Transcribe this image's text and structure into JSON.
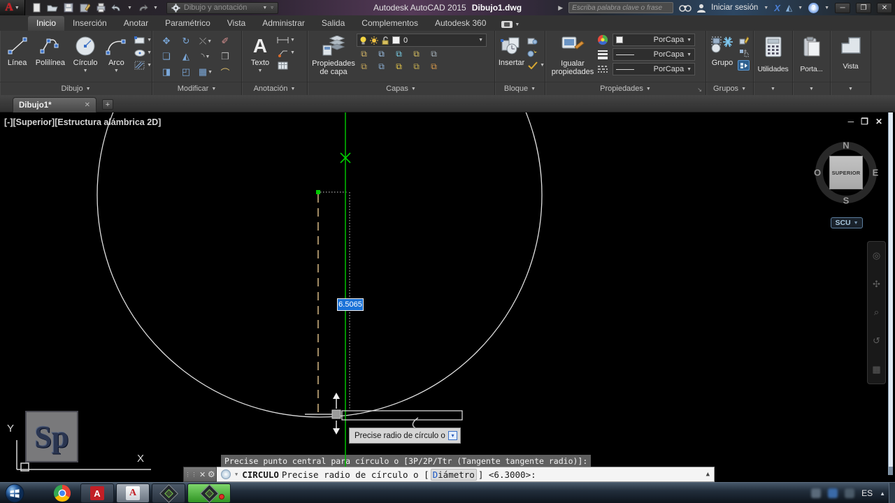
{
  "colors": {
    "accent_green": "#00c800",
    "selection_blue": "#1a72d8",
    "autocad_red": "#c81e23",
    "circle_stroke": "#e0e0e0",
    "tracking_tan": "#9a8560"
  },
  "titlebar": {
    "app_title": "Autodesk AutoCAD 2015",
    "doc_title": "Dibujo1.dwg",
    "workspace": "Dibujo y anotación",
    "search_placeholder": "Escriba palabra clave o frase",
    "signin_label": "Iniciar sesión"
  },
  "ribbon": {
    "tabs": [
      {
        "label": "Inicio",
        "active": true
      },
      {
        "label": "Inserción"
      },
      {
        "label": "Anotar"
      },
      {
        "label": "Paramétrico"
      },
      {
        "label": "Vista"
      },
      {
        "label": "Administrar"
      },
      {
        "label": "Salida"
      },
      {
        "label": "Complementos"
      },
      {
        "label": "Autodesk 360"
      }
    ],
    "dibujo": {
      "label": "Dibujo",
      "linea": "Línea",
      "polilinea": "Polilínea",
      "circulo": "Círculo",
      "arco": "Arco"
    },
    "modificar": {
      "label": "Modificar"
    },
    "anotacion": {
      "label": "Anotación",
      "texto": "Texto"
    },
    "capas": {
      "label": "Capas",
      "propiedades_de_capa": "Propiedades de capa",
      "current_layer": "0"
    },
    "bloque": {
      "label": "Bloque",
      "insertar": "Insertar"
    },
    "propiedades": {
      "label": "Propiedades",
      "igualar": "Igualar propiedades",
      "color": "PorCapa",
      "lineweight": "PorCapa",
      "linetype": "PorCapa"
    },
    "grupos": {
      "label": "Grupos",
      "grupo": "Grupo"
    },
    "utilidades": {
      "label": "Utilidades"
    },
    "portapapeles": {
      "label": "Porta..."
    },
    "vista_panel": {
      "label": "Vista"
    }
  },
  "filetabs": {
    "active_tab": "Dibujo1*"
  },
  "viewport": {
    "label": "[-][Superior][Estructura alámbrica 2D]",
    "viewcube": {
      "north": "N",
      "south": "S",
      "east": "E",
      "west": "O",
      "face": "SUPERIOR"
    },
    "ucs_badge": "SCU"
  },
  "drawing": {
    "dynamic_input_value": "6.5065",
    "tooltip": "Precise radio de círculo o",
    "history_line": "Precise punto central para círculo o [3P/2P/Ttr (Tangente tangente radio)]:",
    "command": {
      "name": "CIRCULO",
      "prompt_before": "Precise radio de círculo o [",
      "option": "Diámetro",
      "prompt_after": "] <6.3000>:"
    },
    "ucs": {
      "x_label": "X",
      "y_label": "Y"
    }
  },
  "watermark": {
    "text": "Sp"
  },
  "taskbar": {
    "language": "ES"
  }
}
